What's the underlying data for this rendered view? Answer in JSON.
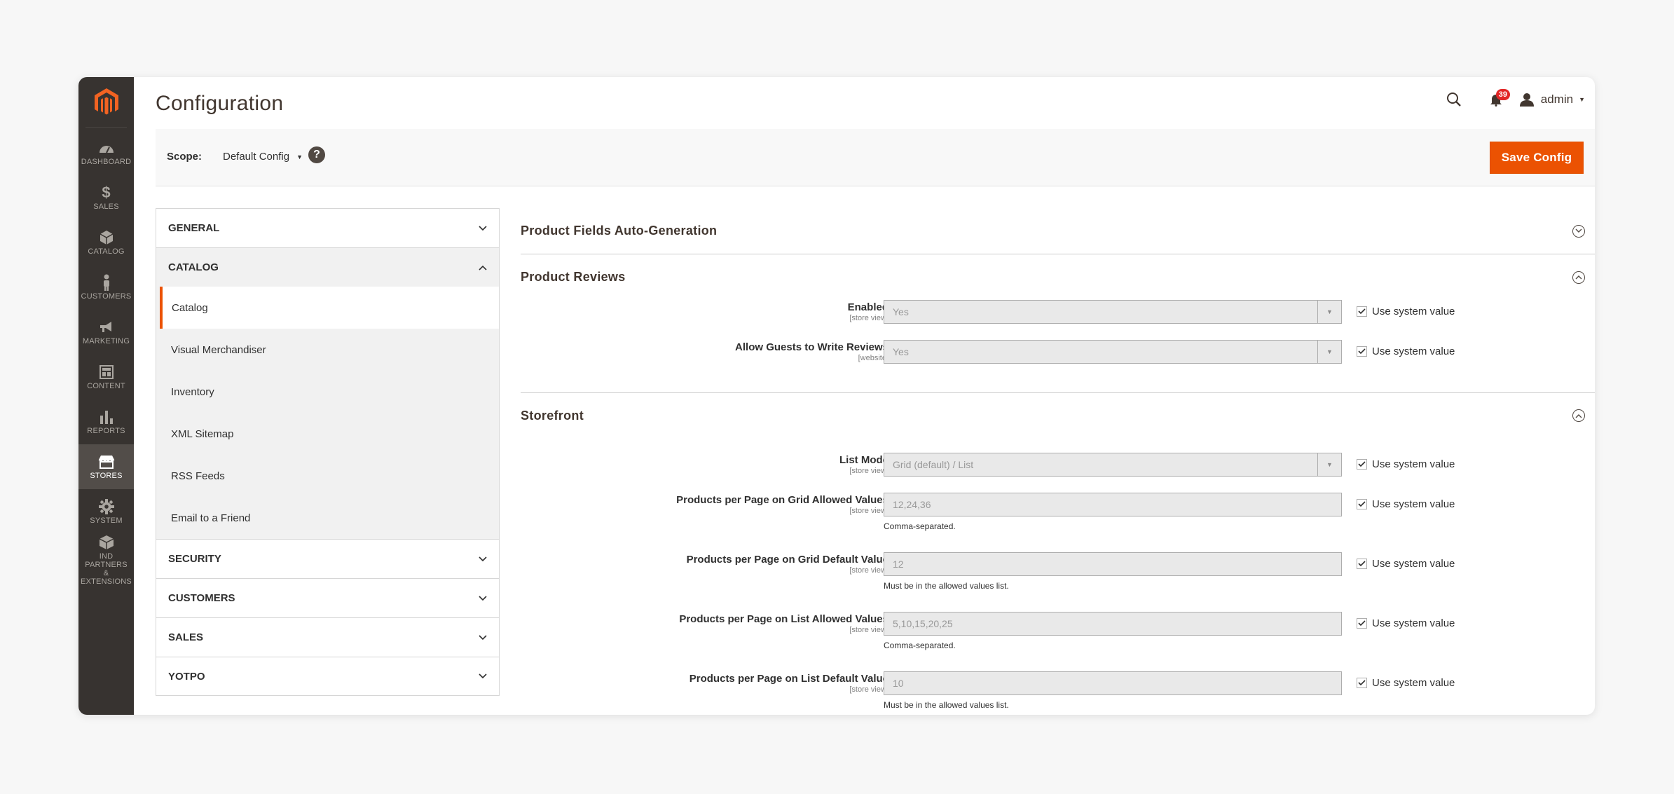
{
  "header": {
    "page_title": "Configuration",
    "notification_count": "39",
    "user_name": "admin"
  },
  "admin_nav": [
    {
      "label": "DASHBOARD",
      "icon": "dashboard-icon"
    },
    {
      "label": "SALES",
      "icon": "dollar-icon"
    },
    {
      "label": "CATALOG",
      "icon": "cube-icon"
    },
    {
      "label": "CUSTOMERS",
      "icon": "person-icon"
    },
    {
      "label": "MARKETING",
      "icon": "megaphone-icon"
    },
    {
      "label": "CONTENT",
      "icon": "layout-icon"
    },
    {
      "label": "REPORTS",
      "icon": "bar-chart-icon"
    },
    {
      "label": "STORES",
      "icon": "store-icon",
      "active": true
    },
    {
      "label": "SYSTEM",
      "icon": "gear-icon"
    },
    {
      "label_line1": "IND PARTNERS",
      "label_line2": "& EXTENSIONS",
      "icon": "box-icon"
    }
  ],
  "scope": {
    "label": "Scope:",
    "value": "Default Config"
  },
  "save_button": "Save Config",
  "tabs": {
    "general": "GENERAL",
    "catalog": "CATALOG",
    "catalog_items": [
      "Catalog",
      "Visual Merchandiser",
      "Inventory",
      "XML Sitemap",
      "RSS Feeds",
      "Email to a Friend"
    ],
    "security": "SECURITY",
    "customers": "CUSTOMERS",
    "sales": "SALES",
    "yotpo": "YOTPO"
  },
  "sections": {
    "auto_generation": "Product Fields Auto-Generation",
    "reviews": {
      "title": "Product Reviews",
      "fields": [
        {
          "label": "Enabled",
          "scope": "[store view]",
          "value": "Yes",
          "check": "Use system value"
        },
        {
          "label": "Allow Guests to Write Reviews",
          "scope": "[website]",
          "value": "Yes",
          "check": "Use system value"
        }
      ]
    },
    "storefront": {
      "title": "Storefront",
      "fields": [
        {
          "label": "List Mode",
          "scope": "[store view]",
          "value": "Grid (default) / List",
          "check": "Use system value"
        },
        {
          "label": "Products per Page on Grid Allowed Values",
          "scope": "[store view]",
          "value": "12,24,36",
          "note": "Comma-separated.",
          "check": "Use system value"
        },
        {
          "label": "Products per Page on Grid Default Value",
          "scope": "[store view]",
          "value": "12",
          "note": "Must be in the allowed values list.",
          "check": "Use system value"
        },
        {
          "label": "Products per Page on List Allowed Values",
          "scope": "[store view]",
          "value": "5,10,15,20,25",
          "note": "Comma-separated.",
          "check": "Use system value"
        },
        {
          "label": "Products per Page on List Default Value",
          "scope": "[store view]",
          "value": "10",
          "note": "Must be in the allowed values list.",
          "check": "Use system value"
        }
      ]
    }
  },
  "colors": {
    "accent": "#eb5202",
    "nav_bg": "#373330"
  }
}
